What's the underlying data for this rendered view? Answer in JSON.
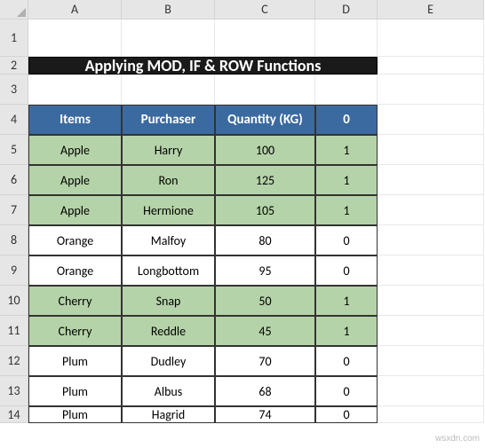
{
  "columns": [
    "A",
    "B",
    "C",
    "D",
    "E"
  ],
  "rows": [
    "1",
    "2",
    "3",
    "4",
    "5",
    "6",
    "7",
    "8",
    "9",
    "10",
    "11",
    "12",
    "13",
    "14"
  ],
  "title": "Applying MOD, IF & ROW Functions",
  "headers": [
    "Items",
    "Purchaser",
    "Quantity (KG)",
    "0"
  ],
  "data": [
    {
      "item": "Apple",
      "purchaser": "Harry",
      "qty": "100",
      "flag": "1",
      "shaded": true
    },
    {
      "item": "Apple",
      "purchaser": "Ron",
      "qty": "125",
      "flag": "1",
      "shaded": true
    },
    {
      "item": "Apple",
      "purchaser": "Hermione",
      "qty": "105",
      "flag": "1",
      "shaded": true
    },
    {
      "item": "Orange",
      "purchaser": "Malfoy",
      "qty": "80",
      "flag": "0",
      "shaded": false
    },
    {
      "item": "Orange",
      "purchaser": "Longbottom",
      "qty": "95",
      "flag": "0",
      "shaded": false
    },
    {
      "item": "Cherry",
      "purchaser": "Snap",
      "qty": "50",
      "flag": "1",
      "shaded": true
    },
    {
      "item": "Cherry",
      "purchaser": "Reddle",
      "qty": "45",
      "flag": "1",
      "shaded": true
    },
    {
      "item": "Plum",
      "purchaser": "Dudley",
      "qty": "70",
      "flag": "0",
      "shaded": false
    },
    {
      "item": "Plum",
      "purchaser": "Albus",
      "qty": "68",
      "flag": "0",
      "shaded": false
    },
    {
      "item": "Plum",
      "purchaser": "Hagrid",
      "qty": "74",
      "flag": "0",
      "shaded": false
    }
  ],
  "watermark": "wsxdn.com",
  "chart_data": {
    "type": "table",
    "title": "Applying MOD, IF & ROW Functions",
    "columns": [
      "Items",
      "Purchaser",
      "Quantity (KG)",
      "0"
    ],
    "rows": [
      [
        "Apple",
        "Harry",
        100,
        1
      ],
      [
        "Apple",
        "Ron",
        125,
        1
      ],
      [
        "Apple",
        "Hermione",
        105,
        1
      ],
      [
        "Orange",
        "Malfoy",
        80,
        0
      ],
      [
        "Orange",
        "Longbottom",
        95,
        0
      ],
      [
        "Cherry",
        "Snap",
        50,
        1
      ],
      [
        "Cherry",
        "Reddle",
        45,
        1
      ],
      [
        "Plum",
        "Dudley",
        70,
        0
      ],
      [
        "Plum",
        "Albus",
        68,
        0
      ],
      [
        "Plum",
        "Hagrid",
        74,
        0
      ]
    ]
  }
}
